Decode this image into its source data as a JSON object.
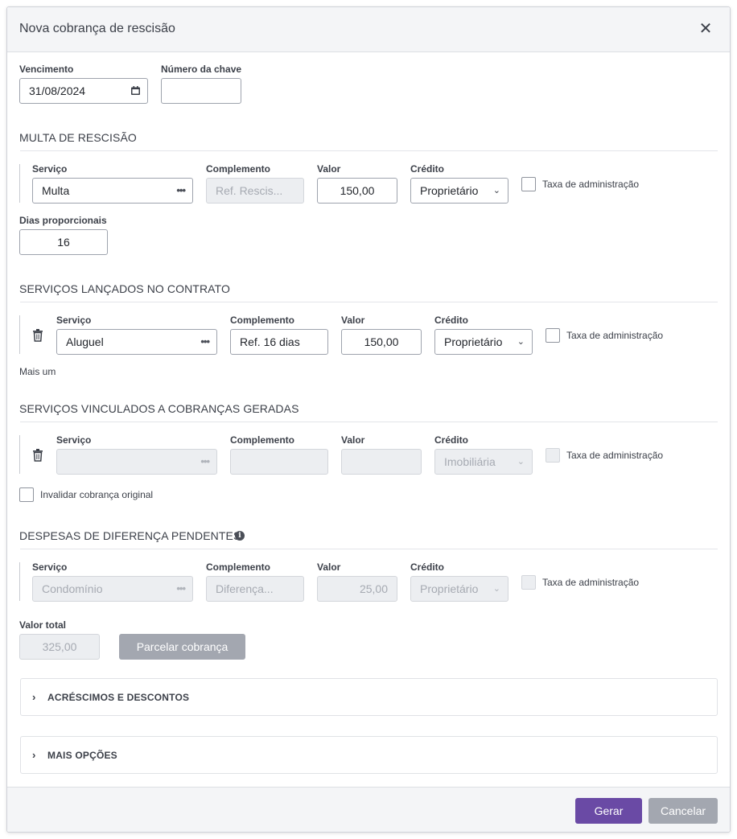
{
  "modal": {
    "title": "Nova cobrança de rescisão"
  },
  "top": {
    "vencimento_label": "Vencimento",
    "vencimento_value": "31/08/2024",
    "chave_label": "Número da chave",
    "chave_value": ""
  },
  "multa": {
    "title": "MULTA DE RESCISÃO",
    "servico_label": "Serviço",
    "servico_value": "Multa",
    "complemento_label": "Complemento",
    "complemento_placeholder": "Ref. Rescis...",
    "valor_label": "Valor",
    "valor_value": "150,00",
    "credito_label": "Crédito",
    "credito_value": "Proprietário",
    "taxa_label": "Taxa de administração",
    "dias_label": "Dias proporcionais",
    "dias_value": "16"
  },
  "servicos": {
    "title": "SERVIÇOS LANÇADOS NO CONTRATO",
    "servico_label": "Serviço",
    "servico_value": "Aluguel",
    "complemento_label": "Complemento",
    "complemento_value": "Ref. 16 dias",
    "valor_label": "Valor",
    "valor_value": "150,00",
    "credito_label": "Crédito",
    "credito_value": "Proprietário",
    "taxa_label": "Taxa de administração",
    "mais_um": "Mais um"
  },
  "vinculados": {
    "title": "SERVIÇOS VINCULADOS A COBRANÇAS GERADAS",
    "servico_label": "Serviço",
    "servico_value": "",
    "complemento_label": "Complemento",
    "complemento_value": "",
    "valor_label": "Valor",
    "valor_value": "",
    "credito_label": "Crédito",
    "credito_value": "Imobiliária",
    "taxa_label": "Taxa de administração",
    "invalidar_label": "Invalidar cobrança original"
  },
  "despesas": {
    "title": "DESPESAS DE DIFERENÇA PENDENTES",
    "servico_label": "Serviço",
    "servico_value": "Condomínio",
    "complemento_label": "Complemento",
    "complemento_value": "Diferença...",
    "valor_label": "Valor",
    "valor_value": "25,00",
    "credito_label": "Crédito",
    "credito_value": "Proprietário",
    "taxa_label": "Taxa de administração"
  },
  "total": {
    "label": "Valor total",
    "value": "325,00",
    "parcelar_label": "Parcelar cobrança"
  },
  "collapsibles": {
    "acrescimos": "ACRÉSCIMOS E DESCONTOS",
    "mais_opcoes": "MAIS OPÇÕES"
  },
  "footer": {
    "gerar_label": "Gerar",
    "cancelar_label": "Cancelar"
  },
  "colors": {
    "primary": "#6a4aa5",
    "disabled_button": "#a3a7b0",
    "header_bg": "#f4f5f7"
  },
  "icons": [
    "close-icon",
    "calendar-icon",
    "ellipsis-icon",
    "chevron-down-icon",
    "trash-icon",
    "info-icon",
    "chevron-right-icon"
  ]
}
